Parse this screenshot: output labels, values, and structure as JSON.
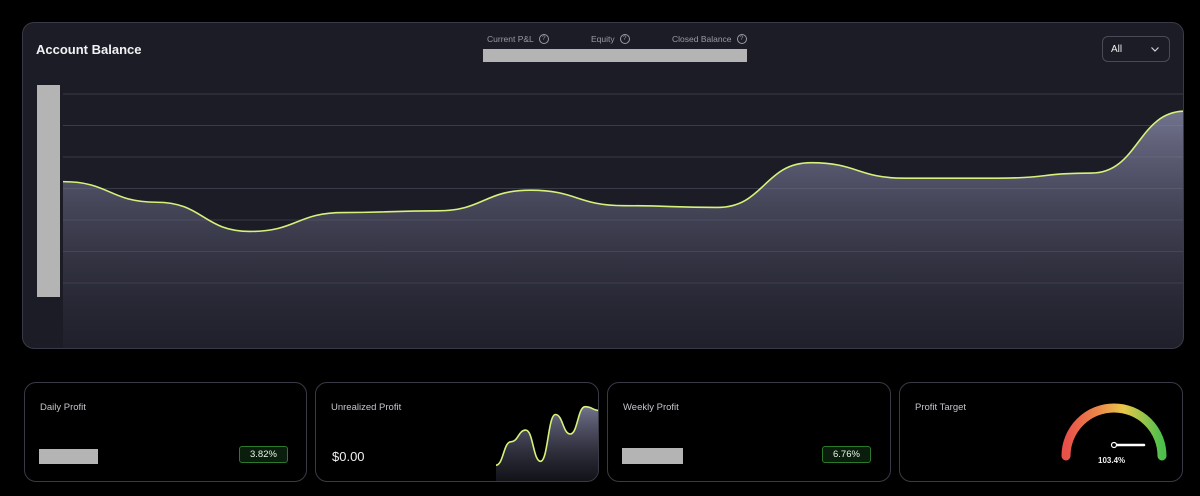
{
  "account_balance": {
    "title": "Account Balance",
    "metrics": [
      {
        "label": "Current P&L",
        "icon": "help-circle-icon"
      },
      {
        "label": "Equity",
        "icon": "help-circle-icon"
      },
      {
        "label": "Closed Balance",
        "icon": "help-circle-icon"
      }
    ],
    "range_select": {
      "value": "All",
      "icon": "chevron-down-icon"
    }
  },
  "chart_data": {
    "type": "area",
    "x": [
      0,
      1,
      2,
      3,
      4,
      5,
      6,
      7,
      8,
      9,
      10,
      11,
      12
    ],
    "values": [
      34,
      22,
      5,
      16,
      17,
      29,
      20,
      19,
      45,
      36,
      36,
      39,
      75
    ],
    "series": [
      {
        "values": [
          34,
          22,
          5,
          16,
          17,
          29,
          20,
          19,
          45,
          36,
          36,
          39,
          75
        ]
      }
    ],
    "grid": true,
    "line_color": "#d6f27a",
    "ylim": [
      -25,
      85
    ]
  },
  "cards": {
    "daily_profit": {
      "title": "Daily Profit",
      "badge": "3.82%"
    },
    "unrealized_profit": {
      "title": "Unrealized Profit",
      "value": "$0.00",
      "sparkline": [
        10,
        40,
        55,
        15,
        75,
        50,
        85,
        80
      ]
    },
    "weekly_profit": {
      "title": "Weekly Profit",
      "badge": "6.76%"
    },
    "profit_target": {
      "title": "Profit Target",
      "value_label": "103.4%",
      "progress": 1.034
    }
  },
  "colors": {
    "accent_line": "#d6f27a",
    "badge_green": "#2a7a2a"
  }
}
